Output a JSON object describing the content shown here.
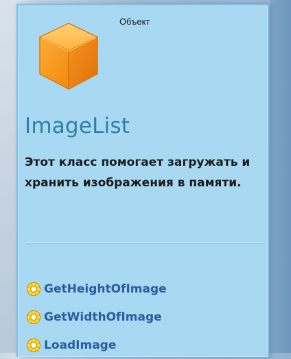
{
  "card": {
    "header": "Объект",
    "icon": "object-cube-icon",
    "title": "ImageList",
    "description": "Этот класс помогает загружать и хранить изображения в памяти."
  },
  "methods": [
    {
      "icon": "method-gear-icon",
      "label": "GetHeightOfImage"
    },
    {
      "icon": "method-gear-icon",
      "label": "GetWidthOfImage"
    },
    {
      "icon": "method-gear-icon",
      "label": "LoadImage"
    }
  ],
  "colors": {
    "card_background": "#a9d9f2",
    "title": "#2c7fa8",
    "method_link": "#2a5c9e",
    "cube_orange": "#f7941d"
  }
}
